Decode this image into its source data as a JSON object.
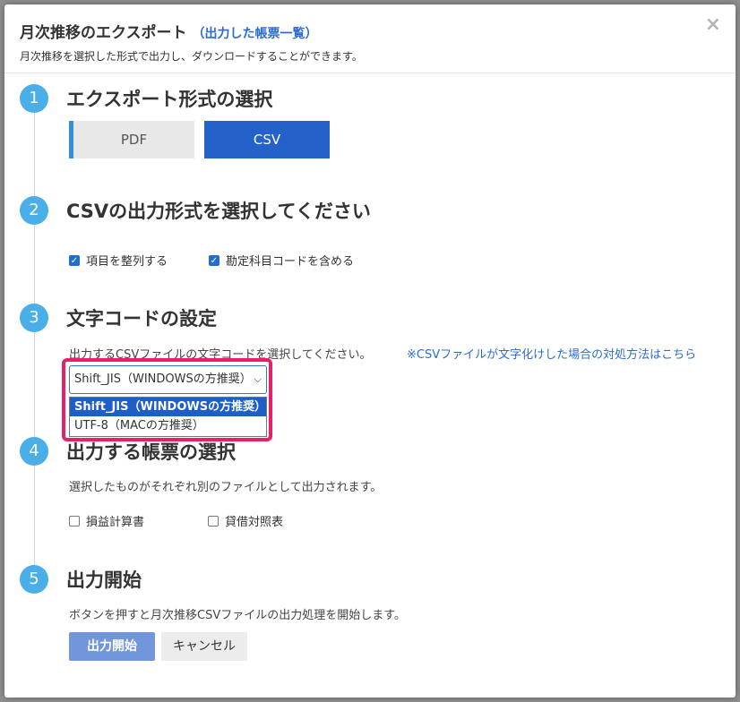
{
  "modal": {
    "title": "月次推移のエクスポート",
    "title_link": "（出力した帳票一覧）",
    "subtitle": "月次推移を選択した形式で出力し、ダウンロードすることができます。",
    "close_icon": "×"
  },
  "steps": [
    {
      "number": "1",
      "title": "エクスポート形式の選択"
    },
    {
      "number": "2",
      "title": "CSVの出力形式を選択してください"
    },
    {
      "number": "3",
      "title": "文字コードの設定"
    },
    {
      "number": "4",
      "title": "出力する帳票の選択"
    },
    {
      "number": "5",
      "title": "出力開始"
    }
  ],
  "format": {
    "pdf_label": "PDF",
    "csv_label": "CSV",
    "selected": "CSV"
  },
  "csv_options": [
    {
      "label": "項目を整列する",
      "checked": true
    },
    {
      "label": "勘定科目コードを含める",
      "checked": true
    }
  ],
  "encoding": {
    "description": "出力するCSVファイルの文字コードを選択してください。",
    "help_link": "※CSVファイルが文字化けした場合の対処方法はこちら",
    "selected_value": "Shift_JIS（WINDOWSの方推奨）",
    "options": [
      "Shift_JIS（WINDOWSの方推奨）",
      "UTF-8（MACの方推奨）"
    ]
  },
  "reports": {
    "description": "選択したものがそれぞれ別のファイルとして出力されます。",
    "items": [
      {
        "label": "損益計算書",
        "checked": false
      },
      {
        "label": "貸借対照表",
        "checked": false
      }
    ]
  },
  "start": {
    "description": "ボタンを押すと月次推移CSVファイルの出力処理を開始します。",
    "start_label": "出力開始",
    "cancel_label": "キャンセル"
  },
  "colors": {
    "accent": "#2461c9",
    "step_circle": "#4aaee8",
    "highlight": "#e8206a"
  }
}
